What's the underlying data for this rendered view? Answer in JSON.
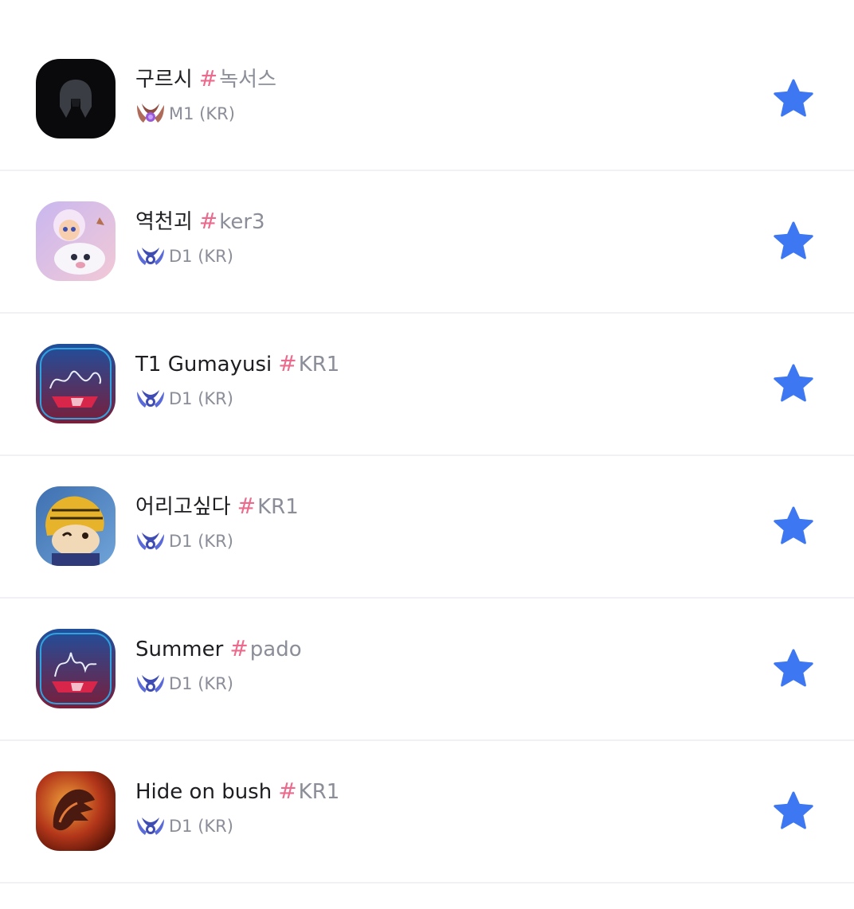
{
  "players": [
    {
      "name": "구르시",
      "hash": "#",
      "tag": "녹서스",
      "tier_icon": "master-emblem-icon",
      "rank": "M1 (KR)",
      "avatar": "dark-helmet-avatar",
      "favorite": true
    },
    {
      "name": "역천괴",
      "hash": "#",
      "tag": "ker3",
      "tier_icon": "diamond-emblem-icon",
      "rank": "D1 (KR)",
      "avatar": "lulu-poro-avatar",
      "favorite": true
    },
    {
      "name": "T1 Gumayusi",
      "hash": "#",
      "tag": "KR1",
      "tier_icon": "diamond-emblem-icon",
      "rank": "D1 (KR)",
      "avatar": "t1-signature-avatar",
      "favorite": true
    },
    {
      "name": "어리고싶다",
      "hash": "#",
      "tag": "KR1",
      "tier_icon": "diamond-emblem-icon",
      "rank": "D1 (KR)",
      "avatar": "bee-teemo-avatar",
      "favorite": true
    },
    {
      "name": "Summer",
      "hash": "#",
      "tag": "pado",
      "tier_icon": "diamond-emblem-icon",
      "rank": "D1 (KR)",
      "avatar": "t1-signature-avatar",
      "favorite": true
    },
    {
      "name": "Hide on bush",
      "hash": "#",
      "tag": "KR1",
      "tier_icon": "diamond-emblem-icon",
      "rank": "D1 (KR)",
      "avatar": "fire-claw-avatar",
      "favorite": true
    }
  ],
  "colors": {
    "star": "#3d77f2",
    "hash": "#ec6a8c",
    "name": "#1e1e22",
    "muted": "#8b8e98",
    "diamond": "#5a6ad8",
    "master": "#b06a5a",
    "divider": "#f0f1f4"
  }
}
